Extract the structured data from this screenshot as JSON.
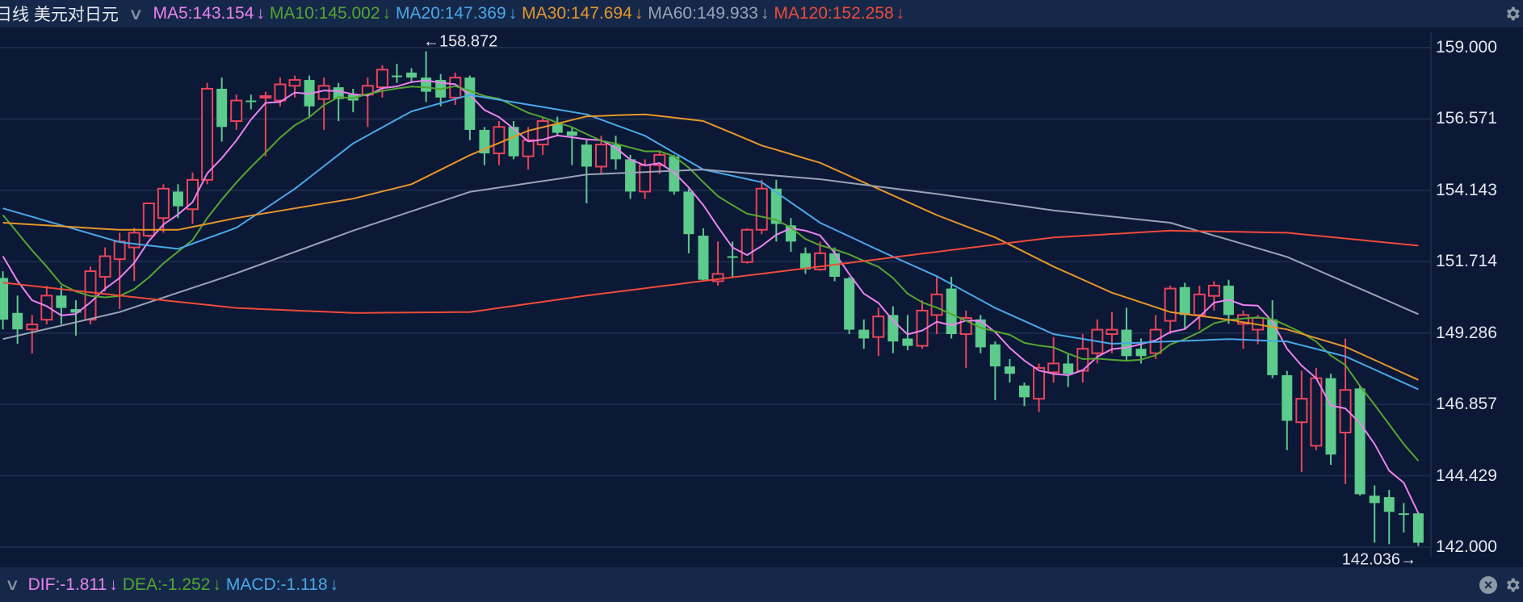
{
  "header": {
    "title": "日线 美元对日元",
    "ma": [
      {
        "label": "MA5:143.154",
        "arrow": "↓",
        "color": "#ee82ee"
      },
      {
        "label": "MA10:145.002",
        "arrow": "↓",
        "color": "#55a630"
      },
      {
        "label": "MA20:147.369",
        "arrow": "↓",
        "color": "#4aa8e8"
      },
      {
        "label": "MA30:147.694",
        "arrow": "↓",
        "color": "#e8962a"
      },
      {
        "label": "MA60:149.933",
        "arrow": "↓",
        "color": "#9aa3b5"
      },
      {
        "label": "MA120:152.258",
        "arrow": "↓",
        "color": "#ee4b3a"
      }
    ]
  },
  "indicator": {
    "items": [
      {
        "label": "DIF:-1.811",
        "arrow": "↓",
        "color": "#ee82ee"
      },
      {
        "label": "DEA:-1.252",
        "arrow": "↓",
        "color": "#55a630"
      },
      {
        "label": "MACD:-1.118",
        "arrow": "↓",
        "color": "#4aa8e8"
      }
    ]
  },
  "icons": {
    "settings": "gear-icon",
    "close": "close-icon",
    "collapse": "chevron-down-icon"
  },
  "chart_data": {
    "type": "candlestick",
    "ylim": [
      142.0,
      159.0
    ],
    "y_ticks": [
      "159.000",
      "156.571",
      "154.143",
      "151.714",
      "149.286",
      "146.857",
      "144.429",
      "142.000"
    ],
    "max_label": "←158.872",
    "min_label": "142.036→",
    "colors": {
      "up": "#e8445a",
      "down": "#5ccb8c",
      "grid": "#1b2b4a"
    },
    "candles": [
      [
        151.16,
        149.74,
        151.39,
        149.41
      ],
      [
        149.97,
        149.41,
        150.56,
        148.92
      ],
      [
        149.41,
        149.58,
        149.9,
        148.59
      ],
      [
        149.74,
        150.56,
        150.89,
        149.58
      ],
      [
        150.56,
        150.14,
        150.89,
        149.58
      ],
      [
        150.1,
        149.98,
        150.4,
        149.2
      ],
      [
        149.74,
        151.39,
        151.55,
        149.58
      ],
      [
        151.2,
        151.9,
        152.2,
        150.7
      ],
      [
        151.8,
        152.4,
        152.7,
        150.1
      ],
      [
        152.2,
        152.7,
        152.87,
        151.06
      ],
      [
        152.6,
        153.7,
        153.7,
        152.54
      ],
      [
        153.2,
        154.2,
        154.35,
        152.7
      ],
      [
        154.1,
        153.6,
        154.35,
        153.2
      ],
      [
        153.5,
        154.5,
        154.75,
        153.0
      ],
      [
        154.5,
        157.6,
        157.8,
        154.35
      ],
      [
        157.6,
        156.3,
        157.98,
        155.8
      ],
      [
        156.5,
        157.2,
        157.4,
        156.2
      ],
      [
        157.2,
        157.15,
        157.4,
        156.9
      ],
      [
        157.3,
        157.35,
        157.5,
        155.3
      ],
      [
        157.2,
        157.75,
        157.98,
        157.0
      ],
      [
        157.7,
        157.9,
        158.05,
        157.3
      ],
      [
        157.9,
        157.0,
        158.05,
        156.65
      ],
      [
        157.25,
        157.7,
        157.98,
        156.2
      ],
      [
        157.65,
        157.25,
        157.8,
        156.5
      ],
      [
        157.4,
        157.2,
        157.6,
        156.8
      ],
      [
        157.4,
        157.7,
        157.98,
        156.3
      ],
      [
        157.65,
        158.25,
        158.4,
        157.3
      ],
      [
        158.05,
        158.0,
        158.45,
        157.8
      ],
      [
        158.15,
        157.98,
        158.3,
        157.8
      ],
      [
        157.98,
        157.5,
        158.872,
        157.15
      ],
      [
        157.9,
        157.3,
        158.1,
        157.0
      ],
      [
        157.3,
        157.98,
        158.15,
        157.05
      ],
      [
        157.98,
        156.2,
        158.05,
        155.85
      ],
      [
        156.2,
        155.4,
        156.3,
        155.0
      ],
      [
        155.4,
        156.3,
        156.5,
        155.0
      ],
      [
        156.3,
        155.3,
        156.5,
        155.2
      ],
      [
        155.3,
        155.85,
        156.3,
        154.85
      ],
      [
        155.7,
        156.5,
        156.65,
        155.35
      ],
      [
        156.4,
        156.1,
        156.65,
        156.0
      ],
      [
        156.15,
        156.0,
        156.3,
        155.0
      ],
      [
        155.7,
        154.95,
        155.85,
        153.7
      ],
      [
        154.95,
        155.7,
        156.0,
        154.7
      ],
      [
        155.7,
        155.2,
        156.0,
        154.85
      ],
      [
        155.2,
        154.1,
        155.35,
        153.85
      ],
      [
        154.1,
        155.0,
        155.2,
        153.85
      ],
      [
        155.0,
        155.35,
        155.5,
        154.7
      ],
      [
        155.3,
        154.1,
        155.35,
        154.0
      ],
      [
        154.1,
        152.65,
        154.2,
        152.0
      ],
      [
        152.6,
        151.1,
        152.85,
        151.05
      ],
      [
        151.05,
        151.3,
        152.4,
        150.9
      ],
      [
        151.9,
        151.85,
        152.4,
        151.2
      ],
      [
        151.7,
        152.8,
        152.85,
        151.65
      ],
      [
        152.8,
        154.2,
        154.5,
        152.65
      ],
      [
        154.2,
        153.0,
        154.5,
        152.4
      ],
      [
        152.95,
        152.4,
        153.2,
        152.05
      ],
      [
        152.0,
        151.45,
        152.2,
        151.3
      ],
      [
        151.45,
        152.0,
        152.4,
        151.4
      ],
      [
        152.0,
        151.2,
        152.2,
        151.05
      ],
      [
        151.15,
        149.4,
        151.2,
        149.25
      ],
      [
        149.4,
        149.1,
        149.75,
        148.75
      ],
      [
        149.15,
        149.85,
        150.15,
        148.5
      ],
      [
        149.9,
        149.0,
        150.2,
        148.6
      ],
      [
        149.1,
        148.85,
        149.9,
        148.7
      ],
      [
        148.85,
        150.05,
        150.4,
        148.75
      ],
      [
        149.9,
        150.6,
        151.2,
        149.25
      ],
      [
        150.8,
        149.25,
        151.2,
        149.1
      ],
      [
        149.25,
        149.8,
        150.05,
        148.1
      ],
      [
        149.75,
        148.8,
        149.9,
        148.6
      ],
      [
        148.9,
        148.15,
        149.0,
        147.0
      ],
      [
        148.15,
        147.9,
        148.4,
        147.6
      ],
      [
        147.5,
        147.1,
        147.6,
        146.8
      ],
      [
        147.05,
        148.1,
        148.25,
        146.6
      ],
      [
        147.95,
        148.25,
        149.15,
        147.6
      ],
      [
        148.25,
        147.9,
        148.6,
        147.45
      ],
      [
        148.0,
        148.75,
        149.25,
        147.6
      ],
      [
        148.6,
        149.4,
        149.75,
        148.25
      ],
      [
        149.25,
        149.4,
        150.0,
        148.6
      ],
      [
        149.4,
        148.5,
        150.15,
        148.35
      ],
      [
        148.75,
        148.5,
        149.1,
        148.25
      ],
      [
        148.6,
        149.4,
        149.9,
        148.4
      ],
      [
        149.7,
        150.8,
        150.9,
        149.25
      ],
      [
        150.85,
        149.9,
        151.0,
        149.4
      ],
      [
        149.9,
        150.6,
        150.9,
        149.4
      ],
      [
        150.55,
        150.9,
        151.05,
        150.05
      ],
      [
        150.9,
        149.9,
        151.1,
        149.6
      ],
      [
        149.6,
        149.9,
        150.05,
        148.75
      ],
      [
        149.4,
        149.8,
        149.9,
        148.9
      ],
      [
        149.75,
        147.85,
        150.4,
        147.75
      ],
      [
        147.85,
        146.3,
        148.0,
        145.3
      ],
      [
        146.25,
        147.05,
        148.0,
        144.55
      ],
      [
        145.45,
        147.75,
        148.1,
        145.3
      ],
      [
        147.75,
        145.15,
        147.9,
        144.8
      ],
      [
        145.9,
        147.35,
        149.1,
        144.15
      ],
      [
        147.4,
        143.8,
        147.5,
        143.75
      ],
      [
        143.75,
        143.5,
        144.1,
        142.15
      ],
      [
        143.7,
        143.2,
        143.95,
        142.1
      ],
      [
        143.15,
        143.12,
        143.5,
        142.5
      ],
      [
        143.15,
        142.15,
        143.2,
        142.036
      ]
    ],
    "candle_fields": [
      "open",
      "close",
      "high",
      "low"
    ],
    "ma_series": [
      {
        "name": "MA5",
        "color": "#ee82ee",
        "period": 5,
        "prefix": [
          151.9,
          151.06,
          150.4,
          150.2
        ]
      },
      {
        "name": "MA10",
        "color": "#55a630",
        "period": 10,
        "prefix": [
          153.3,
          152.7,
          152.1,
          151.55,
          150.95,
          150.7,
          150.55,
          150.5,
          150.55
        ]
      },
      {
        "name": "MA20",
        "color": "#4aa8e8",
        "points": [
          [
            0,
            153.53
          ],
          [
            8,
            152.38
          ],
          [
            12,
            152.15
          ],
          [
            16,
            152.87
          ],
          [
            20,
            154.19
          ],
          [
            24,
            155.74
          ],
          [
            28,
            156.83
          ],
          [
            32,
            157.39
          ],
          [
            36,
            157.06
          ],
          [
            40,
            156.73
          ],
          [
            44,
            156.0
          ],
          [
            48,
            154.85
          ],
          [
            52,
            154.42
          ],
          [
            56,
            153.04
          ],
          [
            60,
            152.11
          ],
          [
            64,
            151.22
          ],
          [
            68,
            150.14
          ],
          [
            72,
            149.25
          ],
          [
            76,
            148.92
          ],
          [
            80,
            149.0
          ],
          [
            84,
            149.08
          ],
          [
            88,
            149.0
          ],
          [
            92,
            148.49
          ],
          [
            97,
            147.37
          ]
        ]
      },
      {
        "name": "MA30",
        "color": "#e8962a",
        "points": [
          [
            0,
            153.04
          ],
          [
            8,
            152.8
          ],
          [
            12,
            152.8
          ],
          [
            16,
            153.2
          ],
          [
            20,
            153.53
          ],
          [
            24,
            153.86
          ],
          [
            28,
            154.35
          ],
          [
            32,
            155.34
          ],
          [
            36,
            156.17
          ],
          [
            40,
            156.66
          ],
          [
            44,
            156.73
          ],
          [
            48,
            156.5
          ],
          [
            52,
            155.67
          ],
          [
            56,
            155.08
          ],
          [
            60,
            154.19
          ],
          [
            64,
            153.3
          ],
          [
            68,
            152.54
          ],
          [
            72,
            151.55
          ],
          [
            76,
            150.66
          ],
          [
            80,
            150.0
          ],
          [
            84,
            149.74
          ],
          [
            88,
            149.41
          ],
          [
            92,
            148.82
          ],
          [
            97,
            147.69
          ]
        ]
      },
      {
        "name": "MA60",
        "color": "#9aa3b5",
        "points": [
          [
            0,
            149.08
          ],
          [
            8,
            150.0
          ],
          [
            16,
            151.32
          ],
          [
            24,
            152.77
          ],
          [
            32,
            154.09
          ],
          [
            40,
            154.68
          ],
          [
            48,
            154.85
          ],
          [
            56,
            154.52
          ],
          [
            64,
            154.02
          ],
          [
            72,
            153.46
          ],
          [
            80,
            153.04
          ],
          [
            88,
            151.88
          ],
          [
            97,
            149.93
          ]
        ]
      },
      {
        "name": "MA120",
        "color": "#ee4b3a",
        "points": [
          [
            0,
            151.0
          ],
          [
            8,
            150.56
          ],
          [
            16,
            150.14
          ],
          [
            24,
            149.97
          ],
          [
            32,
            150.0
          ],
          [
            40,
            150.56
          ],
          [
            48,
            151.06
          ],
          [
            56,
            151.55
          ],
          [
            64,
            152.05
          ],
          [
            72,
            152.54
          ],
          [
            80,
            152.77
          ],
          [
            88,
            152.7
          ],
          [
            97,
            152.26
          ]
        ]
      }
    ]
  }
}
